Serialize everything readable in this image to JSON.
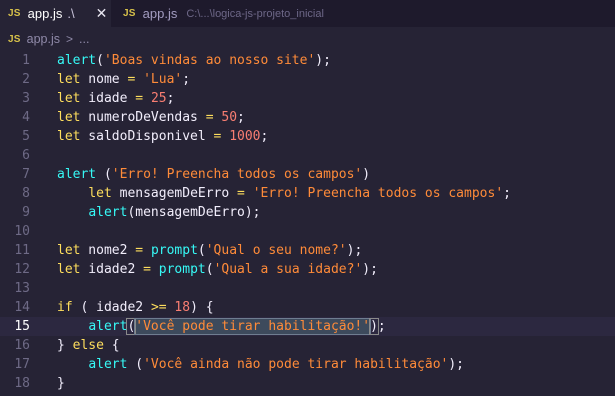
{
  "tabs": [
    {
      "name": "app.js",
      "suffix": ".\\",
      "icon": "JS",
      "close": "✕"
    },
    {
      "name": "app.js",
      "path": "C:\\...\\logica-js-projeto_inicial",
      "icon": "JS"
    }
  ],
  "breadcrumb": {
    "icon": "JS",
    "file": "app.js",
    "separator": ">",
    "more": "..."
  },
  "editor": {
    "active_line": 15,
    "lines": [
      {
        "n": "1",
        "tokens": [
          {
            "t": "alert",
            "c": "fn"
          },
          {
            "t": "(",
            "c": "pun"
          },
          {
            "t": "'Boas vindas ao nosso site'",
            "c": "str"
          },
          {
            "t": ");",
            "c": "pun"
          }
        ]
      },
      {
        "n": "2",
        "tokens": [
          {
            "t": "let",
            "c": "kw"
          },
          {
            "t": " nome ",
            "c": "var"
          },
          {
            "t": "=",
            "c": "op"
          },
          {
            "t": " ",
            "c": "pun"
          },
          {
            "t": "'Lua'",
            "c": "str"
          },
          {
            "t": ";",
            "c": "pun"
          }
        ]
      },
      {
        "n": "3",
        "tokens": [
          {
            "t": "let",
            "c": "kw"
          },
          {
            "t": " idade ",
            "c": "var"
          },
          {
            "t": "=",
            "c": "op"
          },
          {
            "t": " ",
            "c": "pun"
          },
          {
            "t": "25",
            "c": "num"
          },
          {
            "t": ";",
            "c": "pun"
          }
        ]
      },
      {
        "n": "4",
        "tokens": [
          {
            "t": "let",
            "c": "kw"
          },
          {
            "t": " numeroDeVendas ",
            "c": "var"
          },
          {
            "t": "=",
            "c": "op"
          },
          {
            "t": " ",
            "c": "pun"
          },
          {
            "t": "50",
            "c": "num"
          },
          {
            "t": ";",
            "c": "pun"
          }
        ]
      },
      {
        "n": "5",
        "tokens": [
          {
            "t": "let",
            "c": "kw"
          },
          {
            "t": " saldoDisponivel ",
            "c": "var"
          },
          {
            "t": "=",
            "c": "op"
          },
          {
            "t": " ",
            "c": "pun"
          },
          {
            "t": "1000",
            "c": "num"
          },
          {
            "t": ";",
            "c": "pun"
          }
        ]
      },
      {
        "n": "6",
        "tokens": []
      },
      {
        "n": "7",
        "tokens": [
          {
            "t": "alert",
            "c": "fn"
          },
          {
            "t": " (",
            "c": "pun"
          },
          {
            "t": "'Erro! Preencha todos os campos'",
            "c": "str"
          },
          {
            "t": ")",
            "c": "pun"
          }
        ]
      },
      {
        "n": "8",
        "tokens": [
          {
            "t": "    ",
            "c": "pun"
          },
          {
            "t": "let",
            "c": "kw"
          },
          {
            "t": " mensagemDeErro ",
            "c": "var"
          },
          {
            "t": "=",
            "c": "op"
          },
          {
            "t": " ",
            "c": "pun"
          },
          {
            "t": "'Erro! Preencha todos os campos'",
            "c": "str"
          },
          {
            "t": ";",
            "c": "pun"
          }
        ]
      },
      {
        "n": "9",
        "tokens": [
          {
            "t": "    ",
            "c": "pun"
          },
          {
            "t": "alert",
            "c": "fn"
          },
          {
            "t": "(mensagemDeErro);",
            "c": "pun"
          }
        ]
      },
      {
        "n": "10",
        "tokens": []
      },
      {
        "n": "11",
        "tokens": [
          {
            "t": "let",
            "c": "kw"
          },
          {
            "t": " nome2 ",
            "c": "var"
          },
          {
            "t": "=",
            "c": "op"
          },
          {
            "t": " ",
            "c": "pun"
          },
          {
            "t": "prompt",
            "c": "fn"
          },
          {
            "t": "(",
            "c": "pun"
          },
          {
            "t": "'Qual o seu nome?'",
            "c": "str"
          },
          {
            "t": ");",
            "c": "pun"
          }
        ]
      },
      {
        "n": "12",
        "tokens": [
          {
            "t": "let",
            "c": "kw"
          },
          {
            "t": " idade2 ",
            "c": "var"
          },
          {
            "t": "=",
            "c": "op"
          },
          {
            "t": " ",
            "c": "pun"
          },
          {
            "t": "prompt",
            "c": "fn"
          },
          {
            "t": "(",
            "c": "pun"
          },
          {
            "t": "'Qual a sua idade?'",
            "c": "str"
          },
          {
            "t": ");",
            "c": "pun"
          }
        ]
      },
      {
        "n": "13",
        "tokens": []
      },
      {
        "n": "14",
        "tokens": [
          {
            "t": "if",
            "c": "kw"
          },
          {
            "t": " ( idade2 ",
            "c": "var"
          },
          {
            "t": ">=",
            "c": "op"
          },
          {
            "t": " ",
            "c": "pun"
          },
          {
            "t": "18",
            "c": "num"
          },
          {
            "t": ") {",
            "c": "pun"
          }
        ]
      },
      {
        "n": "15",
        "tokens": [
          {
            "t": "    ",
            "c": "pun"
          },
          {
            "t": "alert",
            "c": "fn"
          },
          {
            "t": "(",
            "c": "pun bracket-match"
          },
          {
            "t": "'Você pode tirar habilitação!'",
            "c": "str sel"
          },
          {
            "t": ")",
            "c": "pun bracket-match"
          },
          {
            "t": ";",
            "c": "pun"
          }
        ]
      },
      {
        "n": "16",
        "tokens": [
          {
            "t": "} ",
            "c": "pun"
          },
          {
            "t": "else",
            "c": "kw"
          },
          {
            "t": " {",
            "c": "pun"
          }
        ]
      },
      {
        "n": "17",
        "tokens": [
          {
            "t": "    ",
            "c": "pun"
          },
          {
            "t": "alert",
            "c": "fn"
          },
          {
            "t": " (",
            "c": "pun"
          },
          {
            "t": "'Você ainda não pode tirar habilitação'",
            "c": "str"
          },
          {
            "t": ");",
            "c": "pun"
          }
        ]
      },
      {
        "n": "18",
        "tokens": [
          {
            "t": "}",
            "c": "pun"
          }
        ]
      }
    ]
  }
}
